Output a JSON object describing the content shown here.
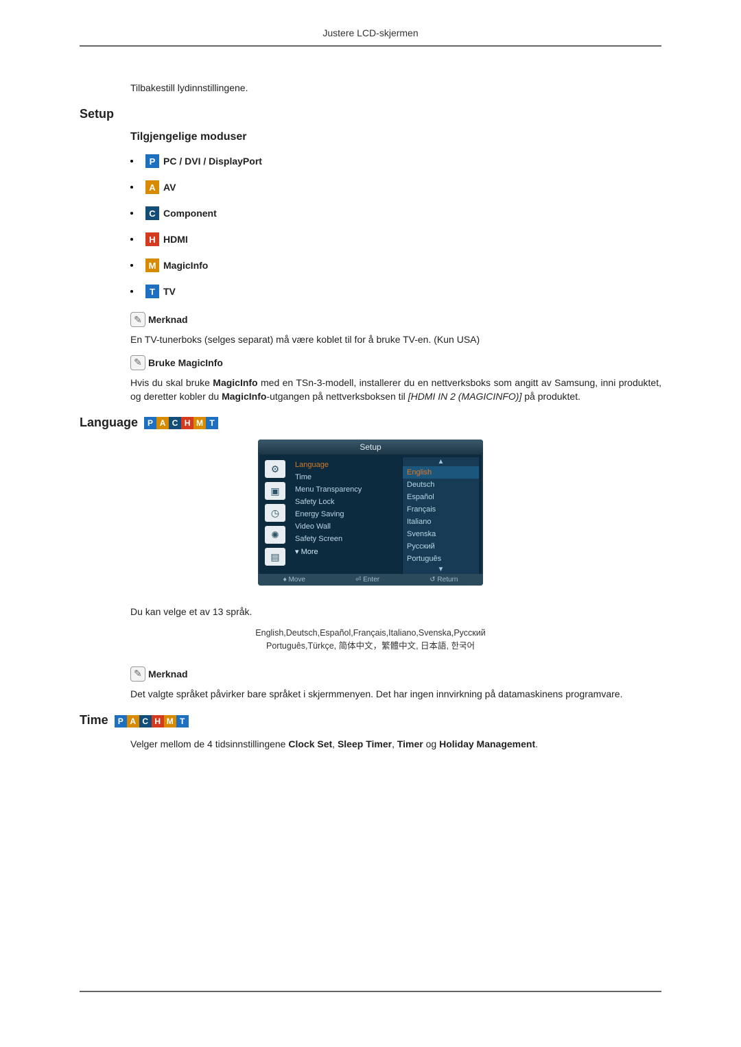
{
  "header": {
    "title": "Justere LCD-skjermen"
  },
  "intro": {
    "text": "Tilbakestill lydinnstillingene."
  },
  "setup": {
    "heading": "Setup",
    "modes_heading": "Tilgjengelige moduser",
    "modes": [
      {
        "letter": "P",
        "cls": "b-p",
        "label": "PC / DVI / DisplayPort"
      },
      {
        "letter": "A",
        "cls": "b-a",
        "label": "AV"
      },
      {
        "letter": "C",
        "cls": "b-c",
        "label": "Component"
      },
      {
        "letter": "H",
        "cls": "b-h",
        "label": "HDMI"
      },
      {
        "letter": "M",
        "cls": "b-m",
        "label": "MagicInfo"
      },
      {
        "letter": "T",
        "cls": "b-t",
        "label": "TV"
      }
    ],
    "note1_label": "Merknad",
    "note1_text": "En TV-tunerboks (selges separat) må være koblet til for å bruke TV-en. (Kun USA)",
    "note2_label": "Bruke MagicInfo",
    "note2_pre": "Hvis du skal bruke ",
    "note2_b1": "MagicInfo",
    "note2_mid1": " med en TSn-3-modell, installerer du en nettverksboks som angitt av Samsung, inni produktet, og deretter kobler du ",
    "note2_b2": "MagicInfo",
    "note2_mid2": "-utgangen på nettverksboksen til ",
    "note2_i": "[HDMI IN 2 (MAGICINFO)]",
    "note2_end": " på produktet."
  },
  "language": {
    "heading": "Language",
    "strip": [
      {
        "letter": "P",
        "cls": "b-p"
      },
      {
        "letter": "A",
        "cls": "b-a"
      },
      {
        "letter": "C",
        "cls": "b-c"
      },
      {
        "letter": "H",
        "cls": "b-h"
      },
      {
        "letter": "M",
        "cls": "b-m"
      },
      {
        "letter": "T",
        "cls": "b-t"
      }
    ],
    "osd": {
      "title": "Setup",
      "menu": [
        {
          "label": "Language",
          "selected": true
        },
        {
          "label": "Time"
        },
        {
          "label": "Menu Transparency"
        },
        {
          "label": "Safety Lock"
        },
        {
          "label": "Energy Saving"
        },
        {
          "label": "Video Wall"
        },
        {
          "label": "Safety Screen"
        }
      ],
      "more": "▾ More",
      "options": [
        {
          "label": "English",
          "selected": true
        },
        {
          "label": "Deutsch"
        },
        {
          "label": "Español"
        },
        {
          "label": "Français"
        },
        {
          "label": "Italiano"
        },
        {
          "label": "Svenska"
        },
        {
          "label": "Русский"
        },
        {
          "label": "Português"
        }
      ],
      "foot_move": "Move",
      "foot_enter": "Enter",
      "foot_return": "Return"
    },
    "count_text": "Du kan velge et av 13 språk.",
    "list_line1": "English,Deutsch,Español,Français,Italiano,Svenska,Русский",
    "list_line2": "Português,Türkçe, 简体中文，繁體中文, 日本語, 한국어",
    "note_label": "Merknad",
    "note_text": "Det valgte språket påvirker bare språket i skjermmenyen. Det har ingen innvirkning på datamaskinens programvare."
  },
  "time": {
    "heading": "Time",
    "strip": [
      {
        "letter": "P",
        "cls": "b-p"
      },
      {
        "letter": "A",
        "cls": "b-a"
      },
      {
        "letter": "C",
        "cls": "b-c"
      },
      {
        "letter": "H",
        "cls": "b-h"
      },
      {
        "letter": "M",
        "cls": "b-m"
      },
      {
        "letter": "T",
        "cls": "b-t"
      }
    ],
    "pre": "Velger mellom de 4 tidsinnstillingene ",
    "b1": "Clock Set",
    "s1": ", ",
    "b2": "Sleep Timer",
    "s2": ", ",
    "b3": "Timer",
    "s3": " og ",
    "b4": "Holiday Management",
    "end": "."
  }
}
